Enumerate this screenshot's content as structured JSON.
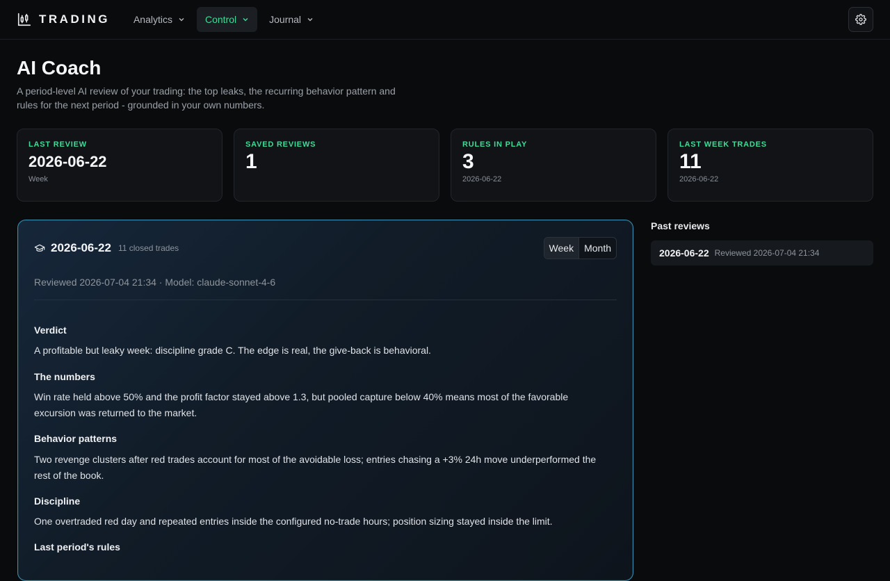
{
  "nav": {
    "brand": "TRADING",
    "items": [
      {
        "label": "Analytics"
      },
      {
        "label": "Control"
      },
      {
        "label": "Journal"
      }
    ]
  },
  "header": {
    "title": "AI Coach",
    "subtitle": "A period-level AI review of your trading: the top leaks, the recurring behavior pattern and rules for the next period - grounded in your own numbers."
  },
  "stats": [
    {
      "label": "LAST REVIEW",
      "value": "2026-06-22",
      "note": "Week"
    },
    {
      "label": "SAVED REVIEWS",
      "value": "1",
      "note": ""
    },
    {
      "label": "RULES IN PLAY",
      "value": "3",
      "note": "2026-06-22"
    },
    {
      "label": "LAST WEEK TRADES",
      "value": "11",
      "note": "2026-06-22"
    }
  ],
  "review": {
    "date": "2026-06-22",
    "count": "11 closed trades",
    "tabs": [
      "Week",
      "Month"
    ],
    "meta": "Reviewed 2026-07-04 21:34 · Model: claude-sonnet-4-6",
    "sections": [
      {
        "heading": "Verdict",
        "text": "A profitable but leaky week: discipline grade C. The edge is real, the give-back is behavioral."
      },
      {
        "heading": "The numbers",
        "text": "Win rate held above 50% and the profit factor stayed above 1.3, but pooled capture below 40% means most of the favorable excursion was returned to the market."
      },
      {
        "heading": "Behavior patterns",
        "text": "Two revenge clusters after red trades account for most of the avoidable loss; entries chasing a +3% 24h move underperformed the rest of the book."
      },
      {
        "heading": "Discipline",
        "text": "One overtraded red day and repeated entries inside the configured no-trade hours; position sizing stayed inside the limit."
      },
      {
        "heading": "Last period's rules",
        "text": ""
      }
    ]
  },
  "past": {
    "title": "Past reviews",
    "items": [
      {
        "date": "2026-06-22",
        "when": "Reviewed 2026-07-04 21:34"
      }
    ]
  },
  "colors": {
    "accent": "#3ddc97",
    "background": "#0a0b0d",
    "card": "#111317",
    "review_border": "#3a8fb3"
  },
  "icons": {
    "brand": "candlestick-chart-icon",
    "settings": "gear-icon",
    "review": "graduation-cap-icon",
    "dropdown": "chevron-down-icon"
  }
}
